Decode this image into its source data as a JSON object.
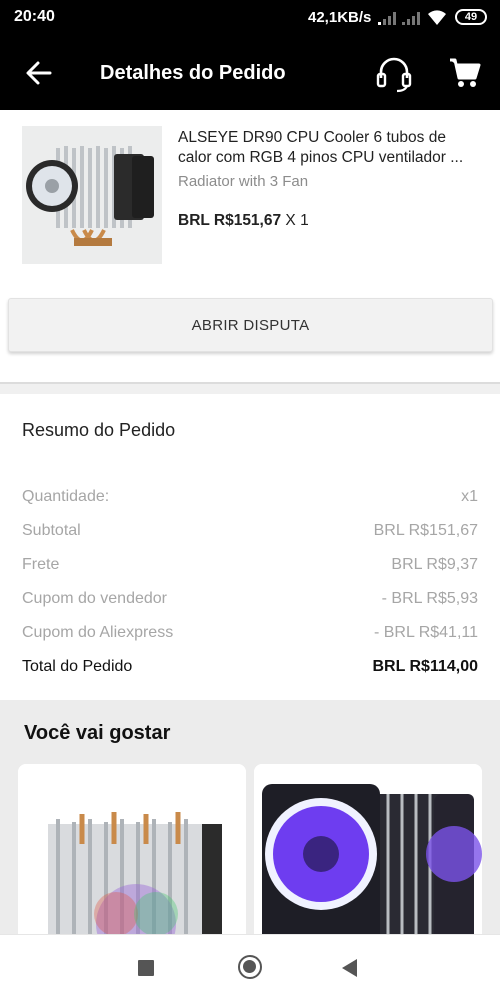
{
  "status_bar": {
    "time": "20:40",
    "net_speed": "42,1KB/s",
    "battery": "49"
  },
  "app_bar": {
    "title": "Detalhes do Pedido",
    "icons": [
      "back-arrow-icon",
      "headset-support-icon",
      "cart-icon"
    ]
  },
  "product": {
    "name": "ALSEYE DR90 CPU Cooler 6 tubos de calor com RGB 4 pinos CPU ventilador ...",
    "variant": "Radiator with 3 Fan",
    "price": "BRL R$151,67",
    "quantity": "X 1"
  },
  "dispute_button": "ABRIR DISPUTA",
  "summary": {
    "title": "Resumo do Pedido",
    "rows": [
      {
        "label": "Quantidade:",
        "value": "x1"
      },
      {
        "label": "Subtotal",
        "value": "BRL R$151,67"
      },
      {
        "label": "Frete",
        "value": "BRL R$9,37"
      },
      {
        "label": "Cupom do vendedor",
        "value": "- BRL R$5,93"
      },
      {
        "label": "Cupom do Aliexpress",
        "value": "- BRL R$41,11"
      },
      {
        "label": "Total do Pedido",
        "value": "BRL R$114,00"
      }
    ]
  },
  "recommendations": {
    "title": "Você vai gostar"
  },
  "colors": {
    "header_bg": "#000000",
    "summary_muted_text": "#a6a6a6",
    "section_bg": "#ececec"
  }
}
